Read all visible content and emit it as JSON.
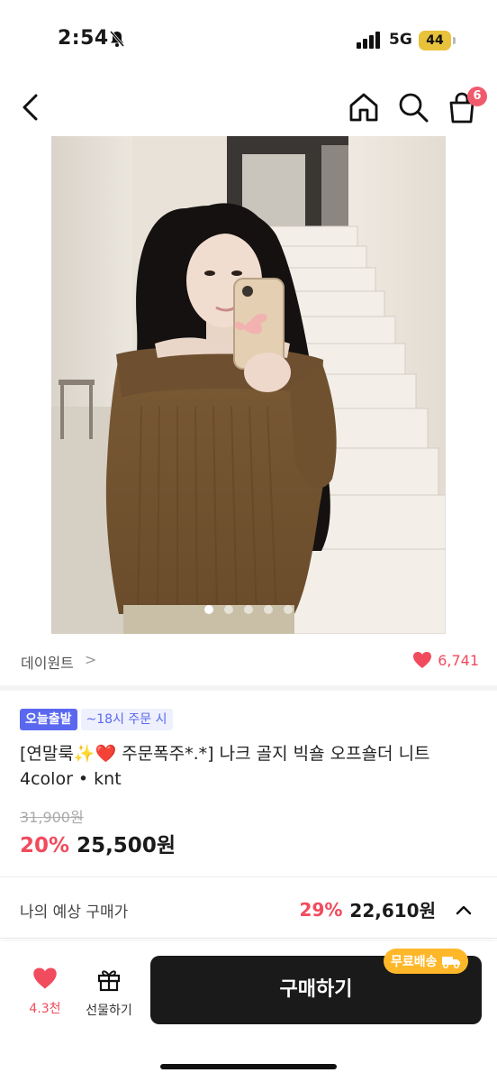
{
  "status_bar": {
    "time": "2:54",
    "network": "5G",
    "battery": "44"
  },
  "nav": {
    "cart_badge": "6"
  },
  "gallery": {
    "dot_count": 5,
    "active_index": 0
  },
  "brand": {
    "name": "데이원트",
    "chevron": ">",
    "likes": "6,741"
  },
  "tags": {
    "primary": "오늘출발",
    "secondary": "~18시 주문 시"
  },
  "product": {
    "title": "[연말룩✨❤️ 주문폭주*.*] 나크 골지 빅숄 오프숄더 니트 4color • knt",
    "original_price": "31,900원",
    "discount": "20%",
    "price": "25,500원"
  },
  "estimate": {
    "label": "나의 예상 구매가",
    "discount": "29%",
    "price": "22,610원"
  },
  "bottom_bar": {
    "like_count": "4.3천",
    "gift_label": "선물하기",
    "buy_label": "구매하기",
    "free_shipping": "무료배송"
  },
  "colors": {
    "accent_red": "#f14b5e",
    "tag_blue": "#5a68f0",
    "buy_button": "#1a1a1a",
    "free_shipping": "#ffb72a"
  }
}
